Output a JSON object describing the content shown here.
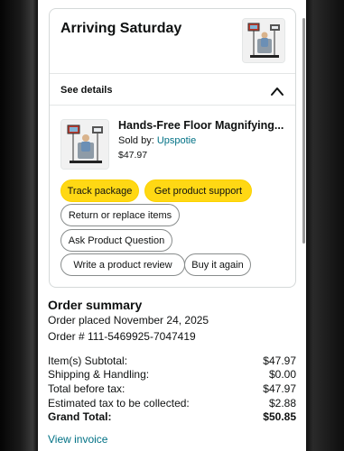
{
  "delivery": {
    "heading": "Arriving Saturday",
    "see_details": "See details"
  },
  "item": {
    "title": "Hands-Free Floor Magnifying...",
    "sold_by_label": "Sold by: ",
    "seller": "Upspotie",
    "price": "$47.97"
  },
  "actions": {
    "track_package": "Track package",
    "get_support": "Get product support",
    "return_replace": "Return or replace items",
    "ask_question": "Ask Product Question",
    "write_review": "Write a product review",
    "buy_again": "Buy it again"
  },
  "summary": {
    "title": "Order summary",
    "order_placed": "Order placed November 24, 2025",
    "order_number": "Order # 111-5469925-7047419",
    "rows": [
      {
        "label": "Item(s) Subtotal:",
        "value": "$47.97"
      },
      {
        "label": "Shipping & Handling:",
        "value": "$0.00"
      },
      {
        "label": "Total before tax:",
        "value": "$47.97"
      },
      {
        "label": "Estimated tax to be collected:",
        "value": "$2.88"
      },
      {
        "label": "Grand Total:",
        "value": "$50.85"
      }
    ],
    "view_invoice": "View invoice"
  },
  "colors": {
    "primary_button": "#ffd814",
    "link": "#007185",
    "border": "#d5d9d9"
  },
  "icons": {
    "collapse": "chevron-up-icon",
    "product_image": "floor-magnifier-product-image"
  }
}
